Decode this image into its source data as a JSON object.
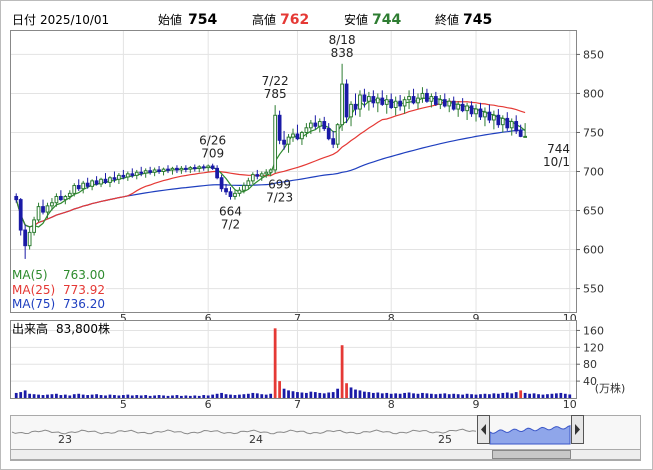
{
  "header": {
    "date_label": "日付",
    "date_value": "2025/10/01",
    "open_label": "始値",
    "open_value": "754",
    "high_label": "高値",
    "high_value": "762",
    "low_label": "安値",
    "low_value": "744",
    "close_label": "終値",
    "close_value": "745"
  },
  "colors": {
    "up": "#2e7d32",
    "down": "#1a1aa6",
    "ma5": "#2e8b2e",
    "ma25": "#e53935",
    "ma75": "#1f3fbf",
    "volume": "#1a1aa6",
    "volume_spike": "#e53935",
    "high_value": "#e53935",
    "low_value": "#2e7d32",
    "nav_area": "#8fa6ea"
  },
  "chart_data": [
    {
      "type": "candlestick",
      "ylim": [
        520,
        880
      ],
      "yticks": [
        "550",
        "600",
        "650",
        "700",
        "750",
        "800",
        "850"
      ],
      "month_labels": [
        "5",
        "6",
        "7",
        "8",
        "9",
        "10"
      ],
      "month_positions": [
        24,
        43,
        63,
        84,
        103,
        124
      ],
      "total_days": 125,
      "ohlc": [
        [
          668,
          672,
          660,
          664
        ],
        [
          664,
          666,
          618,
          625
        ],
        [
          625,
          632,
          588,
          605
        ],
        [
          605,
          630,
          600,
          622
        ],
        [
          622,
          642,
          618,
          638
        ],
        [
          638,
          660,
          635,
          655
        ],
        [
          655,
          664,
          645,
          648
        ],
        [
          648,
          660,
          640,
          656
        ],
        [
          656,
          666,
          650,
          660
        ],
        [
          660,
          672,
          655,
          668
        ],
        [
          668,
          676,
          662,
          664
        ],
        [
          664,
          670,
          658,
          668
        ],
        [
          668,
          676,
          664,
          672
        ],
        [
          672,
          685,
          668,
          682
        ],
        [
          682,
          690,
          675,
          678
        ],
        [
          678,
          688,
          672,
          685
        ],
        [
          685,
          692,
          678,
          681
        ],
        [
          681,
          690,
          676,
          688
        ],
        [
          688,
          694,
          682,
          684
        ],
        [
          684,
          692,
          680,
          690
        ],
        [
          690,
          698,
          684,
          686
        ],
        [
          686,
          694,
          680,
          692
        ],
        [
          692,
          700,
          686,
          690
        ],
        [
          690,
          698,
          684,
          695
        ],
        [
          695,
          702,
          690,
          693
        ],
        [
          693,
          700,
          688,
          697
        ],
        [
          697,
          704,
          692,
          695
        ],
        [
          695,
          702,
          690,
          699
        ],
        [
          699,
          706,
          694,
          698
        ],
        [
          698,
          704,
          692,
          701
        ],
        [
          701,
          706,
          696,
          699
        ],
        [
          699,
          705,
          694,
          702
        ],
        [
          702,
          707,
          697,
          700
        ],
        [
          700,
          705,
          695,
          703
        ],
        [
          703,
          708,
          698,
          702
        ],
        [
          702,
          706,
          696,
          704
        ],
        [
          704,
          708,
          698,
          702
        ],
        [
          702,
          707,
          697,
          704
        ],
        [
          704,
          708,
          699,
          703
        ],
        [
          703,
          707,
          698,
          705
        ],
        [
          705,
          709,
          700,
          704
        ],
        [
          704,
          708,
          699,
          706
        ],
        [
          706,
          709,
          701,
          705
        ],
        [
          705,
          709,
          700,
          707
        ],
        [
          707,
          710,
          702,
          704
        ],
        [
          704,
          708,
          690,
          692
        ],
        [
          692,
          696,
          674,
          678
        ],
        [
          678,
          684,
          670,
          674
        ],
        [
          674,
          680,
          664,
          668
        ],
        [
          668,
          676,
          664,
          672
        ],
        [
          672,
          680,
          668,
          676
        ],
        [
          676,
          686,
          672,
          682
        ],
        [
          682,
          692,
          678,
          688
        ],
        [
          688,
          699,
          684,
          696
        ],
        [
          696,
          702,
          690,
          694
        ],
        [
          694,
          700,
          688,
          697
        ],
        [
          697,
          703,
          692,
          699
        ],
        [
          699,
          704,
          694,
          702
        ],
        [
          702,
          785,
          698,
          772
        ],
        [
          772,
          778,
          735,
          740
        ],
        [
          740,
          752,
          728,
          735
        ],
        [
          735,
          748,
          724,
          744
        ],
        [
          744,
          755,
          738,
          748
        ],
        [
          748,
          760,
          740,
          742
        ],
        [
          742,
          752,
          734,
          750
        ],
        [
          750,
          762,
          744,
          756
        ],
        [
          756,
          766,
          748,
          762
        ],
        [
          762,
          772,
          754,
          758
        ],
        [
          758,
          768,
          750,
          764
        ],
        [
          764,
          770,
          752,
          755
        ],
        [
          755,
          762,
          740,
          742
        ],
        [
          742,
          752,
          730,
          735
        ],
        [
          735,
          762,
          730,
          760
        ],
        [
          760,
          838,
          752,
          812
        ],
        [
          812,
          818,
          762,
          770
        ],
        [
          770,
          790,
          758,
          786
        ],
        [
          786,
          800,
          772,
          780
        ],
        [
          780,
          804,
          770,
          798
        ],
        [
          798,
          806,
          782,
          790
        ],
        [
          790,
          802,
          778,
          796
        ],
        [
          796,
          804,
          782,
          788
        ],
        [
          788,
          800,
          776,
          794
        ],
        [
          794,
          804,
          784,
          786
        ],
        [
          786,
          798,
          774,
          792
        ],
        [
          792,
          800,
          780,
          782
        ],
        [
          782,
          796,
          772,
          790
        ],
        [
          790,
          798,
          778,
          784
        ],
        [
          784,
          796,
          774,
          792
        ],
        [
          792,
          804,
          780,
          796
        ],
        [
          796,
          806,
          786,
          788
        ],
        [
          788,
          800,
          780,
          794
        ],
        [
          794,
          808,
          788,
          800
        ],
        [
          800,
          806,
          788,
          790
        ],
        [
          790,
          800,
          782,
          796
        ],
        [
          796,
          802,
          784,
          786
        ],
        [
          786,
          798,
          780,
          792
        ],
        [
          792,
          800,
          782,
          784
        ],
        [
          784,
          794,
          776,
          790
        ],
        [
          790,
          796,
          778,
          780
        ],
        [
          780,
          790,
          770,
          786
        ],
        [
          786,
          794,
          776,
          778
        ],
        [
          778,
          788,
          766,
          784
        ],
        [
          784,
          790,
          770,
          774
        ],
        [
          774,
          786,
          764,
          780
        ],
        [
          780,
          788,
          766,
          770
        ],
        [
          770,
          782,
          758,
          776
        ],
        [
          776,
          786,
          762,
          766
        ],
        [
          766,
          778,
          754,
          772
        ],
        [
          772,
          780,
          756,
          760
        ],
        [
          760,
          772,
          750,
          768
        ],
        [
          768,
          776,
          752,
          756
        ],
        [
          756,
          768,
          746,
          764
        ],
        [
          764,
          772,
          748,
          752
        ],
        [
          752,
          760,
          744,
          745
        ],
        [
          745,
          762,
          744,
          745
        ]
      ],
      "annotations": [
        {
          "label": "664",
          "sublabel": "7/2",
          "day": 48,
          "value": 664,
          "position": "below"
        },
        {
          "label": "6/26",
          "sublabel": "709",
          "day": 44,
          "value": 709,
          "position": "above"
        },
        {
          "label": "7/22",
          "sublabel": "785",
          "day": 58,
          "value": 785,
          "position": "above"
        },
        {
          "label": "699",
          "sublabel": "7/23",
          "day": 59,
          "value": 699,
          "position": "below"
        },
        {
          "label": "8/18",
          "sublabel": "838",
          "day": 73,
          "value": 838,
          "position": "above"
        },
        {
          "label": "744",
          "sublabel": "10/1",
          "day": 124,
          "value": 744,
          "position": "below"
        }
      ],
      "ma_legend": [
        {
          "name": "MA(5)",
          "value": "763.00"
        },
        {
          "name": "MA(25)",
          "value": "773.92"
        },
        {
          "name": "MA(75)",
          "value": "736.20"
        }
      ]
    },
    {
      "type": "bar",
      "title": "出来高",
      "latest_value": "83,800株",
      "unit": "(万株)",
      "ylim": [
        0,
        180
      ],
      "yticks": [
        "40",
        "80",
        "120",
        "160"
      ],
      "spikes": [
        {
          "day": 58,
          "value": 165
        },
        {
          "day": 73,
          "value": 125
        }
      ],
      "values": [
        12,
        14,
        18,
        10,
        9,
        8,
        7,
        8,
        9,
        10,
        7,
        8,
        6,
        9,
        10,
        8,
        7,
        8,
        9,
        7,
        6,
        8,
        7,
        6,
        7,
        8,
        6,
        7,
        6,
        7,
        5,
        6,
        7,
        6,
        5,
        6,
        7,
        5,
        6,
        5,
        6,
        5,
        7,
        6,
        8,
        10,
        12,
        9,
        8,
        7,
        8,
        9,
        10,
        12,
        11,
        9,
        8,
        10,
        165,
        40,
        22,
        18,
        16,
        14,
        13,
        12,
        15,
        14,
        12,
        11,
        13,
        14,
        22,
        125,
        35,
        25,
        20,
        18,
        15,
        14,
        12,
        13,
        11,
        12,
        10,
        11,
        10,
        12,
        13,
        11,
        10,
        12,
        11,
        10,
        9,
        10,
        11,
        9,
        10,
        9,
        8,
        10,
        9,
        8,
        9,
        10,
        9,
        11,
        10,
        12,
        13,
        11,
        14,
        18,
        12,
        10,
        11,
        9,
        8,
        9,
        10,
        11,
        12,
        10,
        8.4
      ]
    },
    {
      "type": "area",
      "title": "overview",
      "year_labels": [
        "23",
        "24",
        "25"
      ]
    }
  ]
}
